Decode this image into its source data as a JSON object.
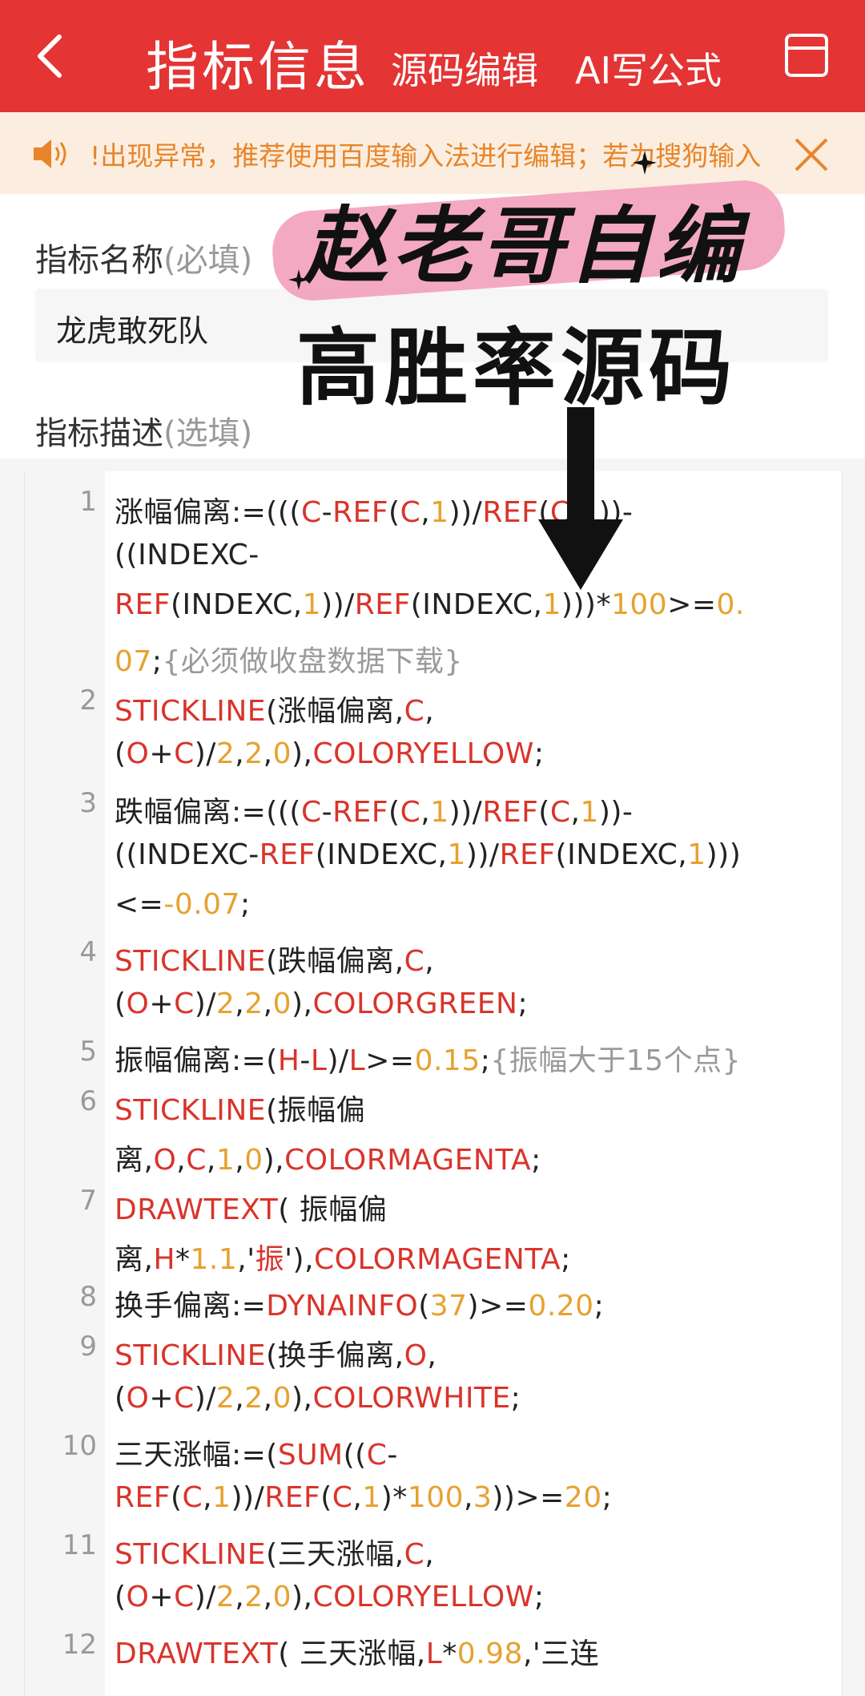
{
  "header": {
    "title": "指标信息",
    "source_edit": "源码编辑",
    "ai_formula": "AI写公式",
    "icons": [
      "back-arrow-icon",
      "save-icon"
    ]
  },
  "notice": {
    "text": "!出现异常，推荐使用百度输入法进行编辑；若为搜狗输入",
    "icons": [
      "speaker-icon",
      "close-icon"
    ]
  },
  "form": {
    "name_label": "指标名称",
    "name_hint": "(必填)",
    "name_value": "龙虎敢死队",
    "desc_label": "指标描述",
    "desc_hint": "(选填)"
  },
  "overlay": {
    "line1": "赵老哥自编",
    "line2": "高胜率源码"
  },
  "code": {
    "line_numbers": [
      "1",
      "2",
      "3",
      "4",
      "5",
      "6",
      "7",
      "8",
      "9",
      "10",
      "11",
      "12"
    ]
  },
  "colors": {
    "header": "#e43434",
    "notice_bg": "#fbeee0",
    "notice_text": "#e8852a",
    "keyword": "#d9342b",
    "number": "#e6a22f",
    "comment": "#9a9a9a"
  }
}
